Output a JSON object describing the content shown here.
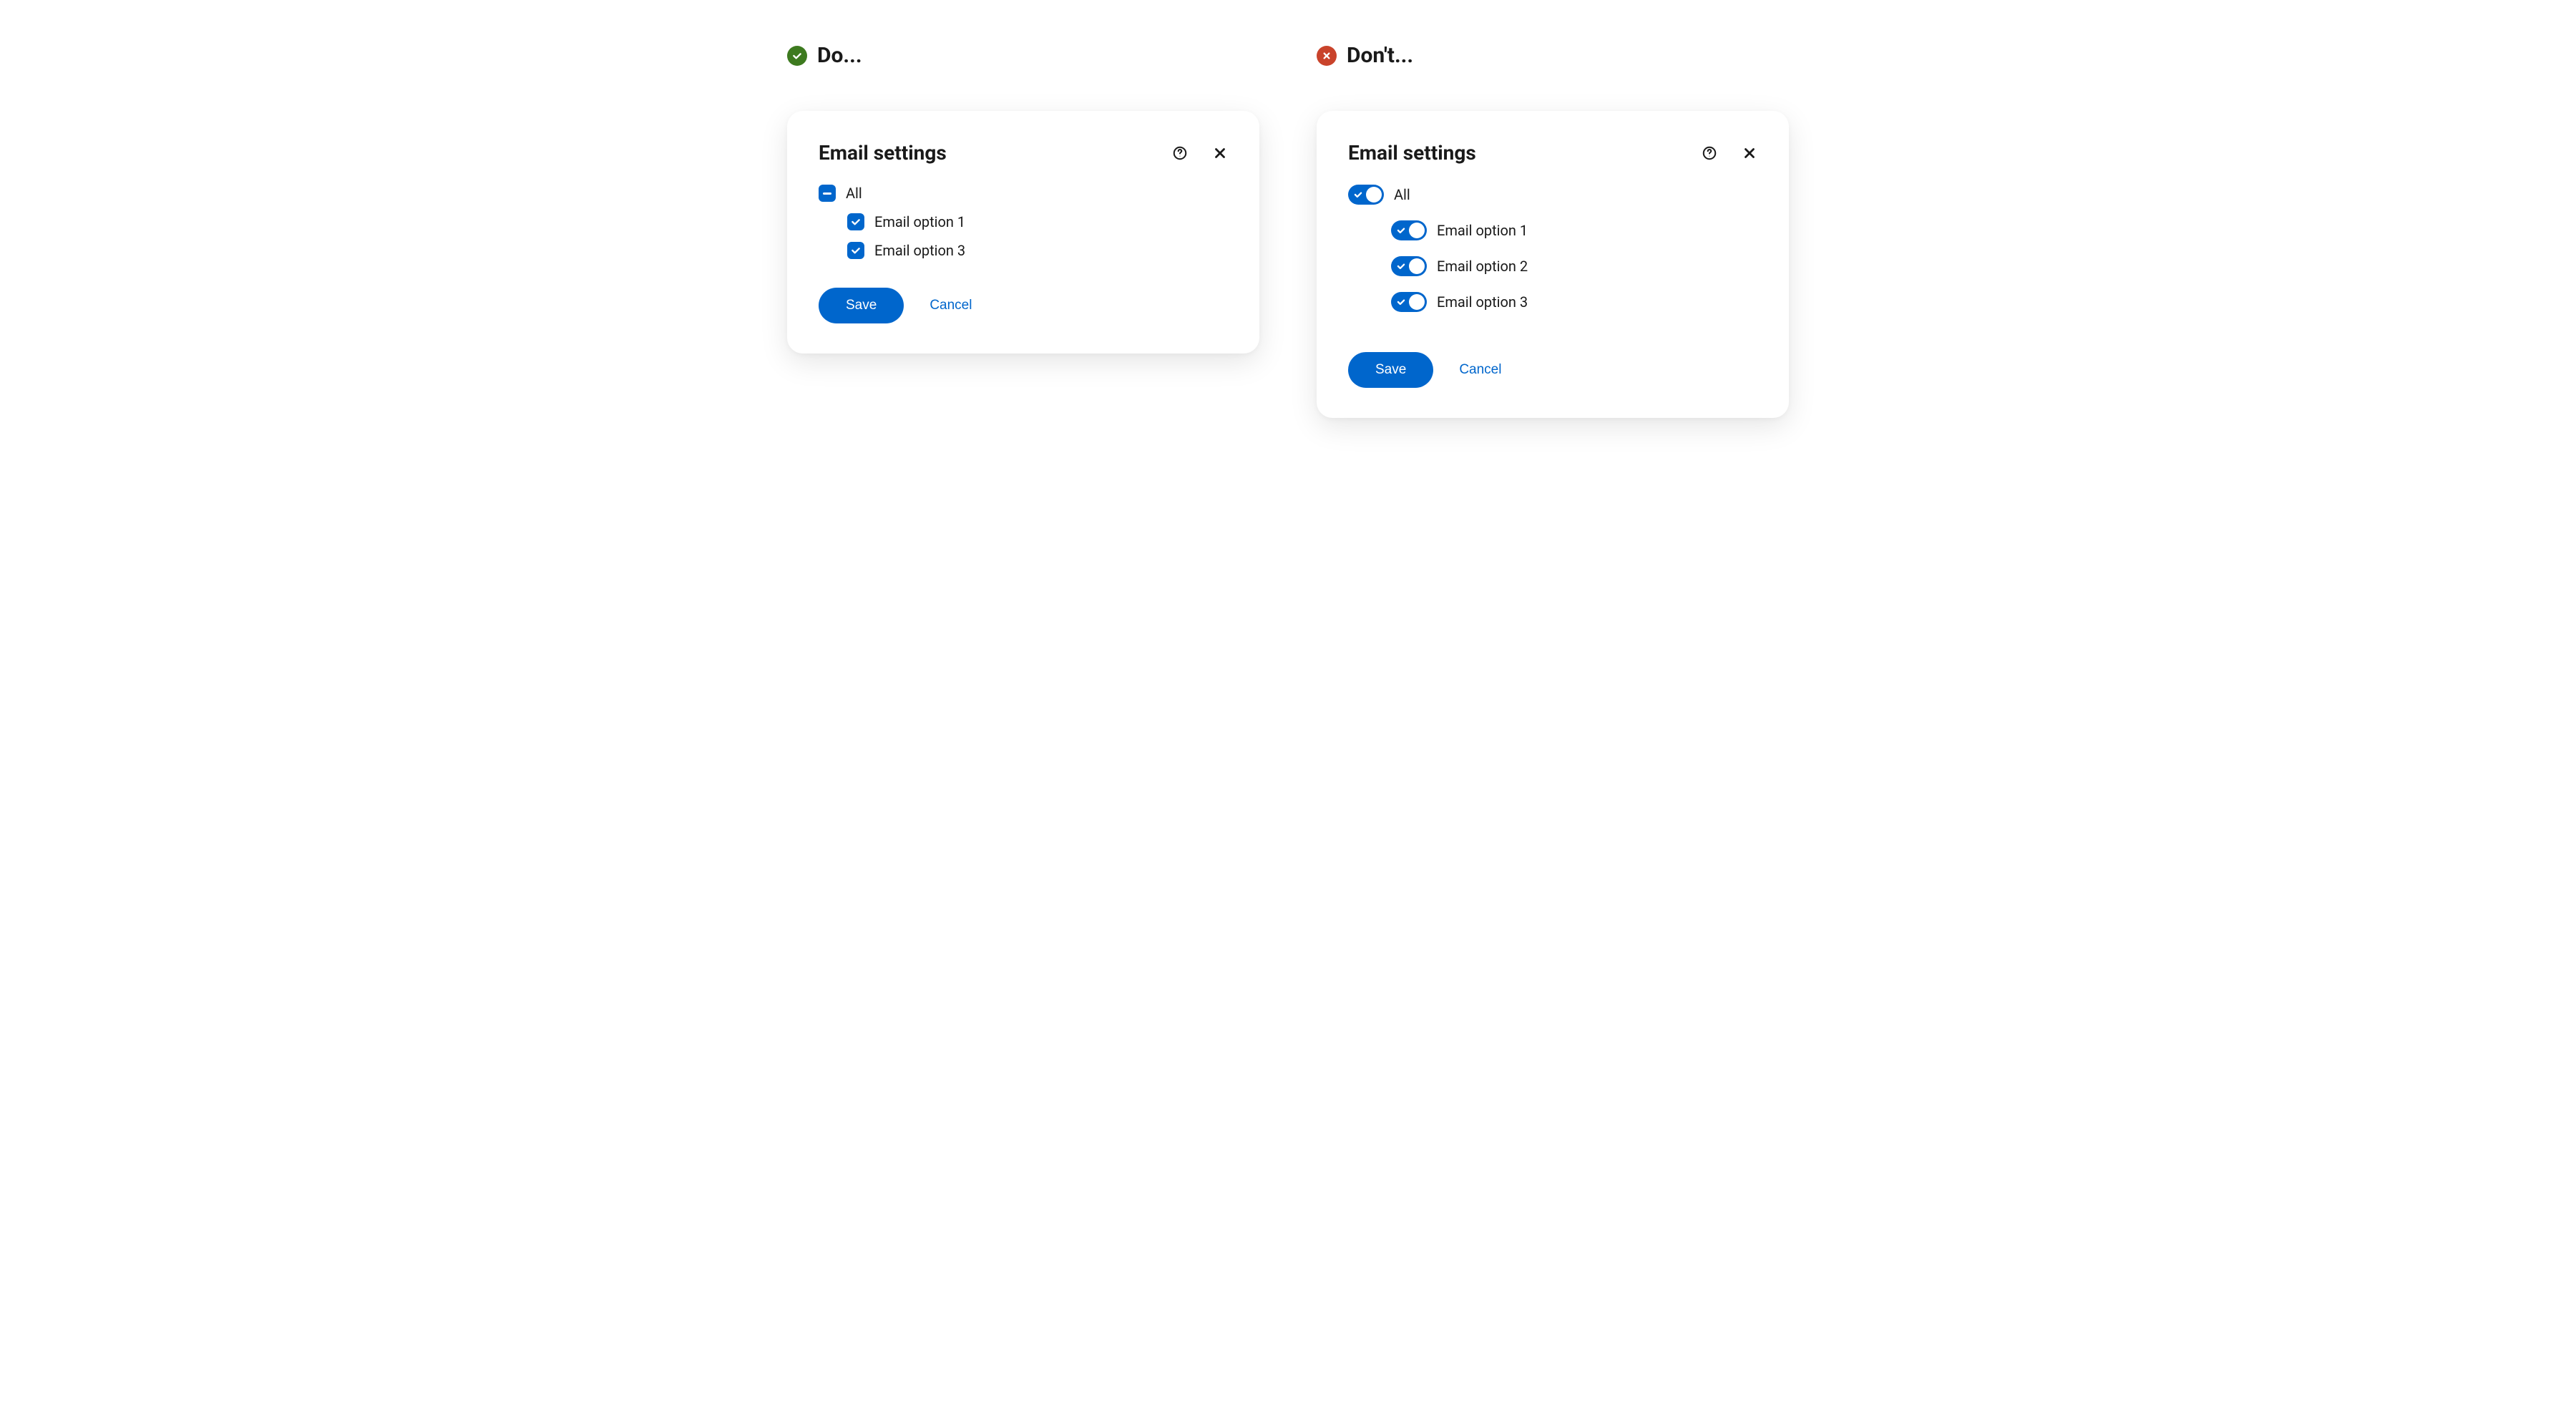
{
  "do": {
    "header": "Do...",
    "card": {
      "title": "Email settings",
      "options": {
        "all": "All",
        "opt1": "Email option 1",
        "opt3": "Email option 3"
      },
      "save": "Save",
      "cancel": "Cancel"
    }
  },
  "dont": {
    "header": "Don't...",
    "card": {
      "title": "Email settings",
      "options": {
        "all": "All",
        "opt1": "Email option 1",
        "opt2": "Email option 2",
        "opt3": "Email option 3"
      },
      "save": "Save",
      "cancel": "Cancel"
    }
  }
}
